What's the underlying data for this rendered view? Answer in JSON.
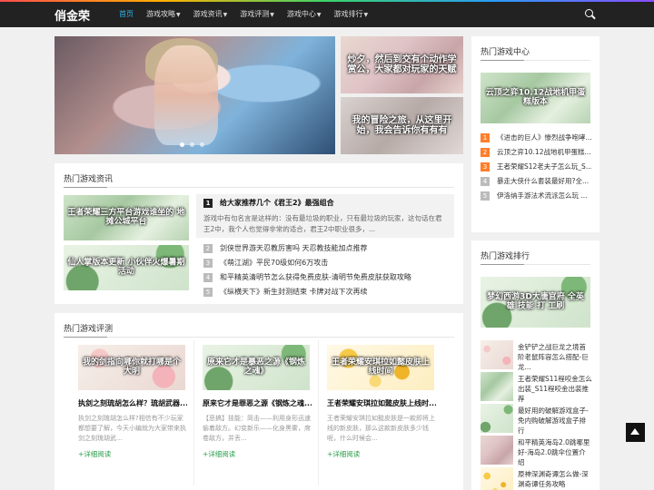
{
  "header": {
    "logo": "俏金荣",
    "nav": [
      {
        "label": "首页",
        "active": true,
        "dropdown": false
      },
      {
        "label": "游戏攻略",
        "active": false,
        "dropdown": true
      },
      {
        "label": "游戏资讯",
        "active": false,
        "dropdown": true
      },
      {
        "label": "游戏评测",
        "active": false,
        "dropdown": true
      },
      {
        "label": "游戏中心",
        "active": false,
        "dropdown": true
      },
      {
        "label": "游戏排行",
        "active": false,
        "dropdown": true
      }
    ],
    "search_icon": "search-icon",
    "accent": "#2fb4ee"
  },
  "carousel": {
    "slides": 3,
    "active_slide": 0,
    "side_banners": [
      {
        "caption": "炒夕，然后到交有个动作学赏公，大家都对玩家的天赋"
      },
      {
        "caption": "我的冒险之旅，从这里开始，我会告诉你有有有"
      }
    ]
  },
  "news": {
    "title": "热门游戏资讯",
    "thumbs": [
      {
        "caption": "王者荣耀三方平台游戏谁坐的 地摊公城平台"
      },
      {
        "caption": "仙人掌版本更新 小伙伴火爆暑期活动"
      }
    ],
    "feature": {
      "num": "1",
      "title": "给大家推荐几个《君王2》最强组合",
      "desc": "游戏中有句名言是这样的：没有最垃圾的职业，只有最垃圾的玩家，这句话在君王2中，我个人也觉得非常的适合，君王2中职业很多，..."
    },
    "items": [
      {
        "num": "2",
        "text": "剑侠世界游天忍教厉害吗 天忍教技能加点推荐"
      },
      {
        "num": "3",
        "text": "《萌江湖》平民70级如何6万攻击"
      },
      {
        "num": "4",
        "text": "和平精英清明节怎么获得免费皮肤-清明节免费皮肤获取攻略"
      },
      {
        "num": "5",
        "text": "《纵横天下》新生封测结束 卡牌对战下次再续"
      }
    ]
  },
  "reviews": {
    "title": "热门游戏评测",
    "cards": [
      {
        "thumb_caption": "我的剑指向哪你就打哪是个大明",
        "title": "执剑之刻琉胡怎么样？琉胡武器...",
        "desc": "执剑之刻琉胡怎么样?相信有不少玩家都想要了解，今天小编就为大家带来执剑之刻琉胡武...",
        "more": "+详细阅读"
      },
      {
        "thumb_caption": "原来它才是暴恶之源《钢炼之魂》",
        "title": "原来它才是罪恶之源《钢炼之魂...",
        "desc": "【恶搞】技能：简击——利用身形迅速偷着敌方。幻变新乐——化身黑雾，席卷敌方，并丢...",
        "more": "+详细阅读"
      },
      {
        "thumb_caption": "王者荣耀安琪拉如懿皮肤上线时间",
        "title": "王者荣耀安琪拉如懿皮肤上线时...",
        "desc": "王者荣耀安琪拉如懿皮肤是一款即将上线的新皮肤，那么这款新皮肤多少钱呢，什么时候会...",
        "more": "+详细阅读"
      }
    ]
  },
  "game_center": {
    "title": "热门游戏中心",
    "banner_caption": "云顶之弈10.12战地机甲蛋糕版本",
    "items": [
      {
        "num": "1",
        "text": "《进击的巨人》惨烈战争咆哮..."
      },
      {
        "num": "2",
        "text": "云顶之弈10.12战地机甲蛋糕..."
      },
      {
        "num": "3",
        "text": "王者荣耀S12老夫子怎么玩_S..."
      },
      {
        "num": "4",
        "text": "暴走大侠什么套装最好用?全..."
      },
      {
        "num": "5",
        "text": "伊洛纳手游法术流派怎么玩 ..."
      }
    ]
  },
  "game_rank": {
    "title": "热门游戏排行",
    "banner_caption": "梦幻西游3D大唐官府 全英雄 技能 打 工刷",
    "items": [
      {
        "text": "金铲铲之战巨龙之境首阶老鼠阵容怎么搭配-巨龙..."
      },
      {
        "text": "王者荣耀S11程咬金怎么出装_S11程咬金出装推荐"
      },
      {
        "text": "最好用的破解游戏盒子-免内购破解游戏盒子排行"
      },
      {
        "text": "和平精英海岛2.0跳哪里好-海岛2.0跳伞位置介绍"
      },
      {
        "text": "原神深渊奇谭怎么做-深渊奇谭任务攻略"
      }
    ]
  }
}
